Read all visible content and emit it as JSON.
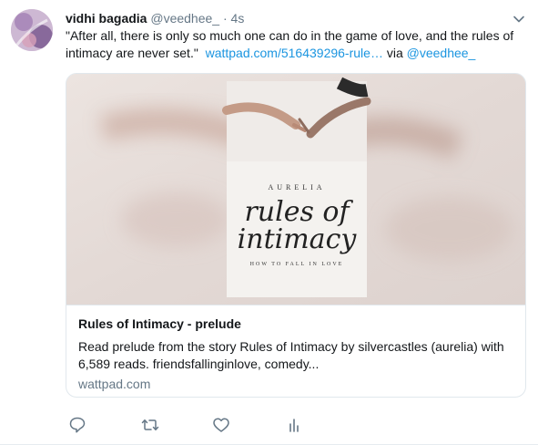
{
  "tweet": {
    "fullname": "vidhi bagadia",
    "username": "@veedhee_",
    "separator": "·",
    "time": "4s",
    "text_quote": "\"After all, there is only so much one can do in the game of love, and the rules of intimacy are never set.\"",
    "link_text": "wattpad.com/516439296-rule…",
    "via_text": "via",
    "mention": "@veedhee_"
  },
  "card": {
    "cover_author": "AURELIA",
    "cover_title_line1": "rules of",
    "cover_title_line2": "intimacy",
    "cover_subtitle": "HOW TO FALL IN LOVE",
    "title": "Rules of Intimacy - prelude",
    "description": "Read prelude from the story Rules of Intimacy by silvercastles (aurelia) with 6,589 reads. friendsfallinginlove, comedy...",
    "domain": "wattpad.com"
  },
  "actions": {
    "icons": [
      "reply-icon",
      "retweet-icon",
      "like-icon",
      "analytics-icon"
    ]
  },
  "colors": {
    "link": "#1b95e0",
    "secondary_text": "#657786",
    "border": "#e1e8ed",
    "icon": "#657786"
  }
}
